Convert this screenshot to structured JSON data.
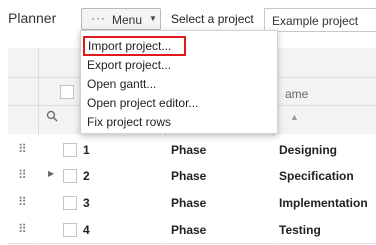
{
  "app": {
    "title": "Planner"
  },
  "toolbar": {
    "menu_label": "Menu",
    "project_label": "Select a project",
    "project_value": "Example project"
  },
  "menu": {
    "items": [
      {
        "label": "Import project..."
      },
      {
        "label": "Export project..."
      },
      {
        "label": "Open gantt..."
      },
      {
        "label": "Open project editor..."
      },
      {
        "label": "Fix project rows"
      }
    ],
    "highlighted_item": "Import project..."
  },
  "grid": {
    "name_column": "ame",
    "rows": [
      {
        "num": "1",
        "type": "Phase",
        "name": "Designing",
        "expandable": false
      },
      {
        "num": "2",
        "type": "Phase",
        "name": "Specification",
        "expandable": true
      },
      {
        "num": "3",
        "type": "Phase",
        "name": "Implementation",
        "expandable": false
      },
      {
        "num": "4",
        "type": "Phase",
        "name": "Testing",
        "expandable": false
      }
    ]
  },
  "colors": {
    "highlight_border": "#e01a1a",
    "header_bg": "#f3f3f3"
  }
}
